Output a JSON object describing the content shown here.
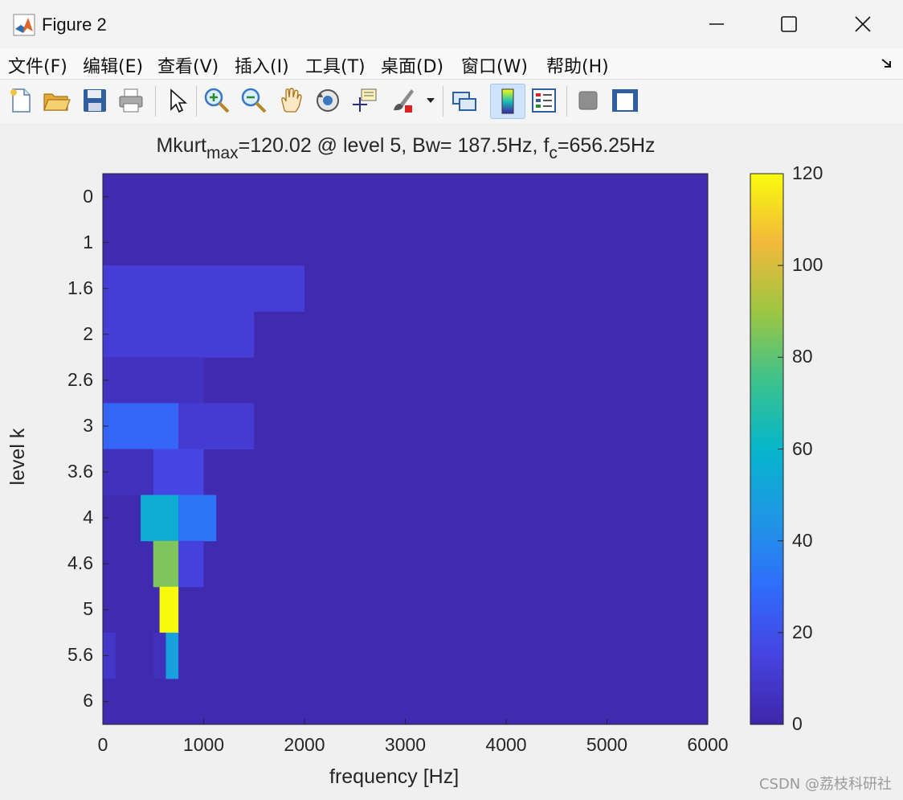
{
  "window": {
    "title": "Figure 2",
    "controls": [
      "minimize-icon",
      "maximize-icon",
      "close-icon"
    ]
  },
  "menu": [
    {
      "label": "文件(F)"
    },
    {
      "label": "编辑(E)"
    },
    {
      "label": "查看(V)"
    },
    {
      "label": "插入(I)"
    },
    {
      "label": "工具(T)"
    },
    {
      "label": "桌面(D)"
    },
    {
      "label": "窗口(W)"
    },
    {
      "label": "帮助(H)"
    }
  ],
  "toolbar": [
    {
      "name": "new-figure-icon"
    },
    {
      "name": "open-file-icon"
    },
    {
      "name": "save-icon"
    },
    {
      "name": "print-icon"
    },
    {
      "name": "pointer-icon"
    },
    {
      "name": "zoom-in-icon"
    },
    {
      "name": "zoom-out-icon"
    },
    {
      "name": "pan-hand-icon"
    },
    {
      "name": "rotate-3d-icon"
    },
    {
      "name": "data-cursor-icon"
    },
    {
      "name": "brush-icon"
    },
    {
      "name": "link-plot-icon"
    },
    {
      "name": "colorbar-icon",
      "active": true
    },
    {
      "name": "legend-icon"
    },
    {
      "name": "hide-plot-tools-icon"
    },
    {
      "name": "show-plot-tools-icon"
    }
  ],
  "chart_data": {
    "type": "heatmap",
    "title_parts": {
      "main": "Mkurt",
      "sub1": "max",
      "mid": "=120.02 @ level 5, Bw= 187.5Hz, f",
      "sub2": "c",
      "end": "=656.25Hz"
    },
    "xlabel": "frequency [Hz]",
    "ylabel": "level k",
    "xlim": [
      0,
      6000
    ],
    "xticks": [
      "0",
      "1000",
      "2000",
      "3000",
      "4000",
      "5000",
      "6000"
    ],
    "levels": [
      "0",
      "1",
      "1.6",
      "2",
      "2.6",
      "3",
      "3.6",
      "4",
      "4.6",
      "5",
      "5.6",
      "6"
    ],
    "colorbar": {
      "range": [
        0,
        120
      ],
      "ticks": [
        "0",
        "20",
        "40",
        "60",
        "80",
        "100",
        "120"
      ]
    },
    "background_value": 2,
    "cells": [
      {
        "level": "1.6",
        "x0": 0,
        "x1": 2000,
        "value": 12
      },
      {
        "level": "2",
        "x0": 0,
        "x1": 1500,
        "value": 12
      },
      {
        "level": "2.6",
        "x0": 0,
        "x1": 1000,
        "value": 6
      },
      {
        "level": "3",
        "x0": 0,
        "x1": 750,
        "value": 27
      },
      {
        "level": "3",
        "x0": 750,
        "x1": 1500,
        "value": 11
      },
      {
        "level": "3.6",
        "x0": 0,
        "x1": 500,
        "value": 5
      },
      {
        "level": "3.6",
        "x0": 500,
        "x1": 1000,
        "value": 16
      },
      {
        "level": "4",
        "x0": 375,
        "x1": 750,
        "value": 55
      },
      {
        "level": "4",
        "x0": 750,
        "x1": 1125,
        "value": 33
      },
      {
        "level": "4.6",
        "x0": 500,
        "x1": 750,
        "value": 85
      },
      {
        "level": "4.6",
        "x0": 750,
        "x1": 1000,
        "value": 14
      },
      {
        "level": "5",
        "x0": 562.5,
        "x1": 750,
        "value": 120.02
      },
      {
        "level": "5.6",
        "x0": 0,
        "x1": 125,
        "value": 9
      },
      {
        "level": "5.6",
        "x0": 500,
        "x1": 625,
        "value": 5
      },
      {
        "level": "5.6",
        "x0": 625,
        "x1": 750,
        "value": 50
      }
    ]
  },
  "watermark": "CSDN @荔枝科研社"
}
